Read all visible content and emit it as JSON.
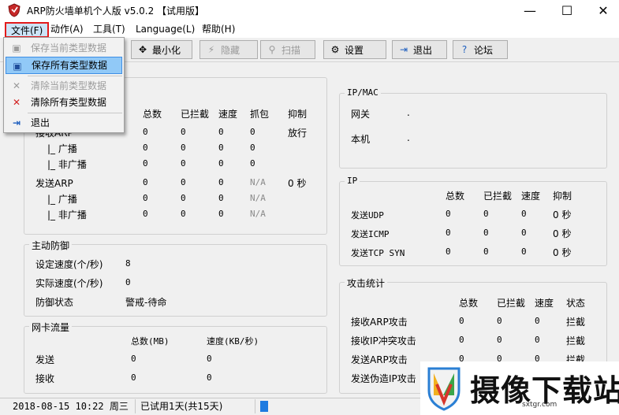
{
  "window": {
    "title": "ARP防火墙单机个人版 v5.0.2 【试用版】",
    "minimize": "—",
    "maximize": "☐",
    "close": "✕"
  },
  "menu": {
    "file": "文件(F)",
    "action": "动作(A)",
    "tools": "工具(T)",
    "language": "Language(L)",
    "help": "帮助(H)"
  },
  "file_menu": {
    "items": [
      {
        "label": "保存当前类型数据",
        "icon": "save-icon",
        "enabled": false
      },
      {
        "label": "保存所有类型数据",
        "icon": "save-icon",
        "enabled": true,
        "highlighted": true
      },
      {
        "label": "清除当前类型数据",
        "icon": "delete-icon",
        "enabled": false
      },
      {
        "label": "清除所有类型数据",
        "icon": "delete-icon",
        "enabled": true
      },
      {
        "label": "退出",
        "icon": "exit-icon",
        "enabled": true
      }
    ]
  },
  "toolbar": {
    "minimize": "最小化",
    "hide": "隐藏",
    "scan": "扫描",
    "settings": "设置",
    "exit": "退出",
    "forum": "论坛"
  },
  "arp_stats": {
    "headers": [
      "总数",
      "已拦截",
      "速度",
      "抓包",
      "抑制"
    ],
    "rows": [
      {
        "label": "接收ARP",
        "values": [
          "0",
          "0",
          "0",
          "0",
          "放行"
        ]
      },
      {
        "label": "|_ 广播",
        "values": [
          "0",
          "0",
          "0",
          "0",
          ""
        ]
      },
      {
        "label": "|_ 非广播",
        "values": [
          "0",
          "0",
          "0",
          "0",
          ""
        ]
      },
      {
        "label": "发送ARP",
        "values": [
          "0",
          "0",
          "0",
          "N/A",
          "0 秒"
        ]
      },
      {
        "label": "|_ 广播",
        "values": [
          "0",
          "0",
          "0",
          "N/A",
          ""
        ]
      },
      {
        "label": "|_ 非广播",
        "values": [
          "0",
          "0",
          "0",
          "N/A",
          ""
        ]
      }
    ]
  },
  "active_defense": {
    "title": "主动防御",
    "set_speed_label": "设定速度(个/秒)",
    "set_speed": "8",
    "actual_speed_label": "实际速度(个/秒)",
    "actual_speed": "0",
    "state_label": "防御状态",
    "state": "警戒-待命"
  },
  "nic_traffic": {
    "title": "网卡流量",
    "headers": [
      "总数(MB)",
      "速度(KB/秒)"
    ],
    "rows": [
      {
        "label": "发送",
        "values": [
          "0",
          "0"
        ]
      },
      {
        "label": "接收",
        "values": [
          "0",
          "0"
        ]
      }
    ]
  },
  "ipmac": {
    "title": "IP/MAC",
    "gateway_label": "网关",
    "gateway": ".",
    "local_label": "本机",
    "local": "."
  },
  "ip": {
    "title": "IP",
    "headers": [
      "总数",
      "已拦截",
      "速度",
      "抑制"
    ],
    "rows": [
      {
        "label": "发送UDP",
        "values": [
          "0",
          "0",
          "0",
          "0 秒"
        ]
      },
      {
        "label": "发送ICMP",
        "values": [
          "0",
          "0",
          "0",
          "0 秒"
        ]
      },
      {
        "label": "发送TCP SYN",
        "values": [
          "0",
          "0",
          "0",
          "0 秒"
        ]
      }
    ]
  },
  "attack_stats": {
    "title": "攻击统计",
    "headers": [
      "总数",
      "已拦截",
      "速度",
      "状态"
    ],
    "rows": [
      {
        "label": "接收ARP攻击",
        "values": [
          "0",
          "0",
          "0",
          "拦截"
        ]
      },
      {
        "label": "接收IP冲突攻击",
        "values": [
          "0",
          "0",
          "0",
          "拦截"
        ]
      },
      {
        "label": "发送ARP攻击",
        "values": [
          "0",
          "0",
          "0",
          "拦截"
        ]
      },
      {
        "label": "发送伪造IP攻击",
        "values": [
          "0",
          "0",
          "0",
          "拦截"
        ]
      }
    ]
  },
  "status": {
    "datetime": "2018-08-15 10:22 周三",
    "trial": "已试用1天(共15天)"
  },
  "watermark": {
    "text": "摄像下载站",
    "url": "sxtgr.com"
  },
  "colors": {
    "highlight_border": "#e21b1b",
    "menu_highlight": "#91c9f7",
    "status_blue": "#1e7be0"
  }
}
